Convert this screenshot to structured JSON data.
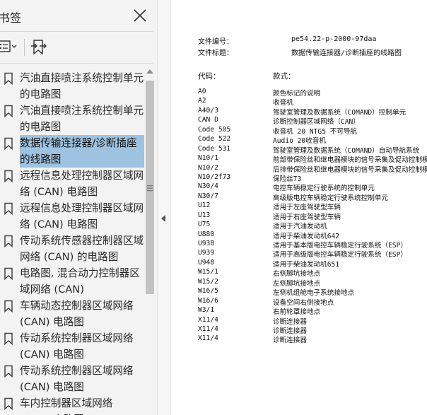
{
  "bookmarks_panel": {
    "title": "书签",
    "bookmarks": [
      {
        "label": "汽油直接喷注系统控制单元的电路图",
        "selected": false
      },
      {
        "label": "汽油直接喷注系统控制单元的电路图",
        "selected": false
      },
      {
        "label": "数据传输连接器/诊断插座的线路图",
        "selected": true
      },
      {
        "label": "远程信息处理控制器区域网络 (CAN) 电路图",
        "selected": false
      },
      {
        "label": "远程信息处理控制器区域网络 (CAN) 电路图",
        "selected": false
      },
      {
        "label": "传动系统传感器控制器区域网络 (CAN) 的电路图",
        "selected": false
      },
      {
        "label": "电路图, 混合动力控制器区域网络 (CAN)",
        "selected": false
      },
      {
        "label": "车辆动态控制器区域网络 (CAN) 电路图",
        "selected": false
      },
      {
        "label": "传动系统控制器区域网络 (CAN) 电路图",
        "selected": false
      },
      {
        "label": "传动系统控制器区域网络 (CAN) 电路图",
        "selected": false
      },
      {
        "label": "车内控制器区域网络 (CAN) 电路图",
        "selected": false
      }
    ],
    "scroll_thumb_fraction": 0.62
  },
  "document": {
    "doc_number_label": "文件编号：",
    "doc_number_value": "pe54.22-p-2000-97daa",
    "doc_title_label": "文件标题：",
    "doc_title_value": "数据传输连接器/诊断插座的线路图",
    "code_header": "代码：",
    "desc_header": "款式：",
    "rows": [
      {
        "code": "A0",
        "desc": "颜色标记的说明"
      },
      {
        "code": "A2",
        "desc": "收音机"
      },
      {
        "code": "A40/3",
        "desc": "驾驶室管理及数据系统（COMAND）控制单元"
      },
      {
        "code": "CAN D",
        "desc": "诊断控制器区域网络（CAN）"
      },
      {
        "code": "Code 505",
        "desc": "收音机 20 NTG5 不可导航"
      },
      {
        "code": "Code 522",
        "desc": "Audio 20收音机"
      },
      {
        "code": "Code 531",
        "desc": "驾驶室管理及数据系统（COMAND）自动导航系统"
      },
      {
        "code": "N10/1",
        "desc": "前部带保险丝和继电器模块的信号采集及促动控制模块"
      },
      {
        "code": "N10/2",
        "desc": "后排带保险丝和继电器模块的信号采集及促动控制模块"
      },
      {
        "code": "N10/2f73",
        "desc": "保险丝73"
      },
      {
        "code": "N30/4",
        "desc": "电控车辆稳定行驶系统的控制单元"
      },
      {
        "code": "N30/7",
        "desc": "高级版电控车辆稳定行驶系统控制单元"
      },
      {
        "code": "U12",
        "desc": "适用于左座驾驶型车辆"
      },
      {
        "code": "U13",
        "desc": "适用于右座驾驶型车辆"
      },
      {
        "code": "U75",
        "desc": "适用于汽油发动机"
      },
      {
        "code": "U880",
        "desc": "适用于柴油发动机642"
      },
      {
        "code": "U938",
        "desc": "适用于基本版电控车辆稳定行驶系统（ESP）"
      },
      {
        "code": "U939",
        "desc": "适用于高级版电控车辆稳定行驶系统（ESP）"
      },
      {
        "code": "U948",
        "desc": "适用于柴油发动机651"
      },
      {
        "code": "W15/1",
        "desc": "右侧脚坑接地点"
      },
      {
        "code": "W15/2",
        "desc": "左侧脚坑接地点"
      },
      {
        "code": "W16/5",
        "desc": "左侧机组舱电子系统接地点"
      },
      {
        "code": "W16/6",
        "desc": "设备空间右侧接地点"
      },
      {
        "code": "W3/1",
        "desc": "右前轮罩接地点"
      },
      {
        "code": "X11/4",
        "desc": "诊断连接器"
      },
      {
        "code": "X11/4",
        "desc": "诊断连接器"
      },
      {
        "code": "X11/4",
        "desc": "诊断连接器"
      }
    ]
  },
  "colors": {
    "panel_bg": "#f3f3f3",
    "selection": "#9ec3e0",
    "page_bg": "#ffffff"
  },
  "icons": {
    "close": "close-icon",
    "options": "options-icon",
    "find_bookmark": "find-bookmark-icon",
    "bookmark": "bookmark-icon"
  }
}
